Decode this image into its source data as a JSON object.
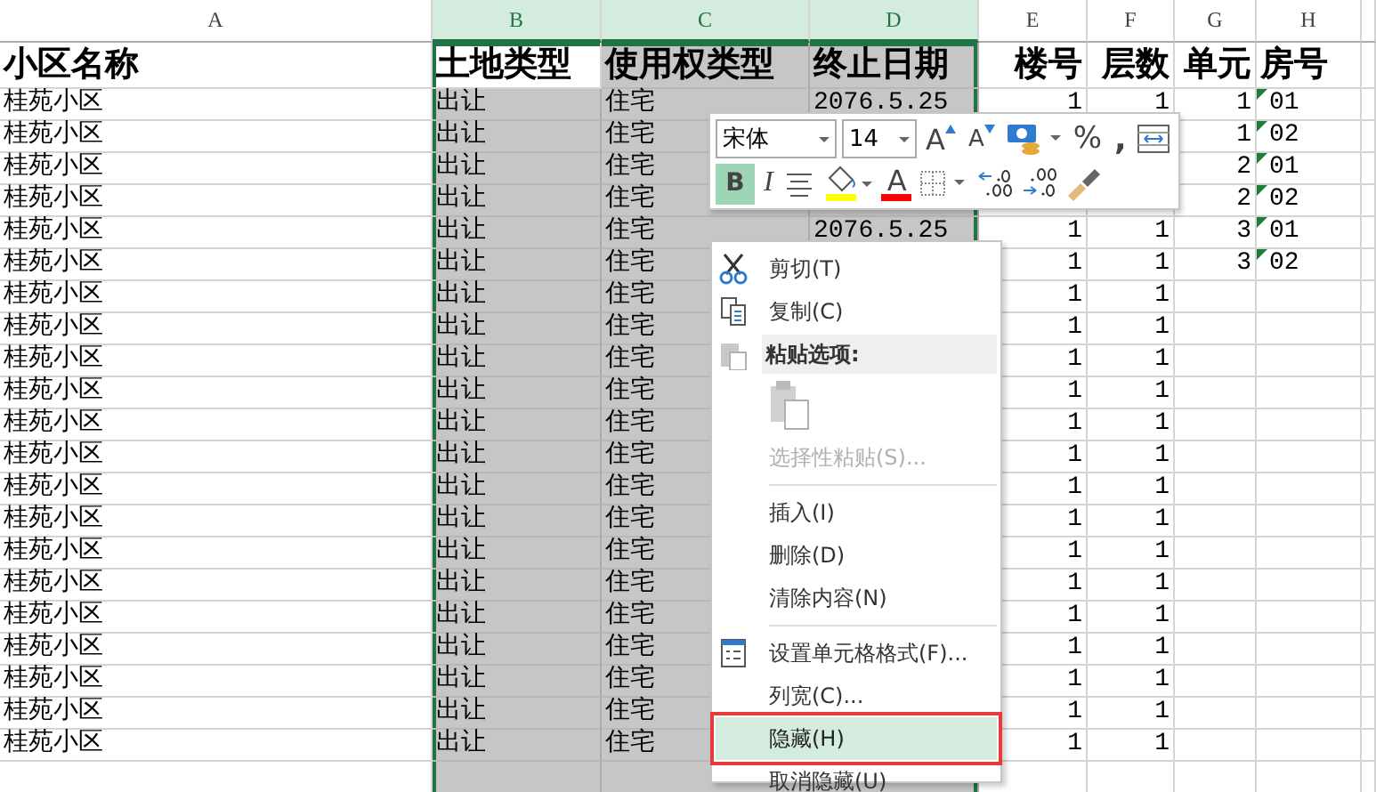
{
  "columns": [
    {
      "label": "A",
      "selected": false
    },
    {
      "label": "B",
      "selected": true
    },
    {
      "label": "C",
      "selected": true
    },
    {
      "label": "D",
      "selected": true
    },
    {
      "label": "E",
      "selected": false
    },
    {
      "label": "F",
      "selected": false
    },
    {
      "label": "G",
      "selected": false
    },
    {
      "label": "H",
      "selected": false
    }
  ],
  "header_row": [
    {
      "text": "小区名称",
      "active": false
    },
    {
      "text": "土地类型",
      "active": true
    },
    {
      "text": "使用权类型",
      "active": false
    },
    {
      "text": "终止日期",
      "active": false
    },
    {
      "text": "楼号",
      "active": false
    },
    {
      "text": "层数",
      "active": false
    },
    {
      "text": "单元",
      "active": false
    },
    {
      "text": "房号",
      "active": false
    }
  ],
  "rows": [
    {
      "cells": [
        "桂苑小区",
        "出让",
        "住宅",
        "2076.5.25",
        "1",
        "1",
        "1",
        "01"
      ],
      "text_number_flag": true
    },
    {
      "cells": [
        "桂苑小区",
        "出让",
        "住宅",
        null,
        null,
        null,
        "1",
        "02"
      ],
      "text_number_flag": true
    },
    {
      "cells": [
        "桂苑小区",
        "出让",
        "住宅",
        null,
        null,
        null,
        "2",
        "01"
      ],
      "text_number_flag": true
    },
    {
      "cells": [
        "桂苑小区",
        "出让",
        "住宅",
        null,
        null,
        null,
        "2",
        "02"
      ],
      "text_number_flag": true
    },
    {
      "cells": [
        "桂苑小区",
        "出让",
        "住宅",
        "2076.5.25",
        "1",
        "1",
        "3",
        "01"
      ],
      "text_number_flag": true
    },
    {
      "cells": [
        "桂苑小区",
        "出让",
        "住宅",
        null,
        "1",
        "1",
        "3",
        "02"
      ],
      "text_number_flag": true
    },
    {
      "cells": [
        "桂苑小区",
        "出让",
        "住宅",
        null,
        "1",
        "1",
        null,
        null
      ],
      "text_number_flag": false
    },
    {
      "cells": [
        "桂苑小区",
        "出让",
        "住宅",
        null,
        "1",
        "1",
        null,
        null
      ],
      "text_number_flag": false
    },
    {
      "cells": [
        "桂苑小区",
        "出让",
        "住宅",
        null,
        "1",
        "1",
        null,
        null
      ],
      "text_number_flag": false
    },
    {
      "cells": [
        "桂苑小区",
        "出让",
        "住宅",
        null,
        "1",
        "1",
        null,
        null
      ],
      "text_number_flag": false
    },
    {
      "cells": [
        "桂苑小区",
        "出让",
        "住宅",
        null,
        "1",
        "1",
        null,
        null
      ],
      "text_number_flag": false
    },
    {
      "cells": [
        "桂苑小区",
        "出让",
        "住宅",
        null,
        "1",
        "1",
        null,
        null
      ],
      "text_number_flag": false
    },
    {
      "cells": [
        "桂苑小区",
        "出让",
        "住宅",
        null,
        "1",
        "1",
        null,
        null
      ],
      "text_number_flag": false
    },
    {
      "cells": [
        "桂苑小区",
        "出让",
        "住宅",
        null,
        "1",
        "1",
        null,
        null
      ],
      "text_number_flag": false
    },
    {
      "cells": [
        "桂苑小区",
        "出让",
        "住宅",
        null,
        "1",
        "1",
        null,
        null
      ],
      "text_number_flag": false
    },
    {
      "cells": [
        "桂苑小区",
        "出让",
        "住宅",
        null,
        "1",
        "1",
        null,
        null
      ],
      "text_number_flag": false
    },
    {
      "cells": [
        "桂苑小区",
        "出让",
        "住宅",
        null,
        "1",
        "1",
        null,
        null
      ],
      "text_number_flag": false
    },
    {
      "cells": [
        "桂苑小区",
        "出让",
        "住宅",
        null,
        "1",
        "1",
        null,
        null
      ],
      "text_number_flag": false
    },
    {
      "cells": [
        "桂苑小区",
        "出让",
        "住宅",
        null,
        "1",
        "1",
        null,
        null
      ],
      "text_number_flag": false
    },
    {
      "cells": [
        "桂苑小区",
        "出让",
        "住宅",
        null,
        "1",
        "1",
        null,
        null
      ],
      "text_number_flag": false
    },
    {
      "cells": [
        "桂苑小区",
        "出让",
        "住宅",
        null,
        "1",
        "1",
        null,
        null
      ],
      "text_number_flag": false
    }
  ],
  "mini_toolbar": {
    "font": "宋体",
    "size": "14",
    "row1": [
      {
        "kind": "grow",
        "label": "A"
      },
      {
        "kind": "shrink",
        "label": "A"
      },
      {
        "kind": "accounting"
      },
      {
        "kind": "percent",
        "label": "%"
      },
      {
        "kind": "comma",
        "label": ","
      },
      {
        "kind": "merge"
      }
    ],
    "row2": [
      {
        "kind": "bold",
        "label": "B",
        "selected": true
      },
      {
        "kind": "italic",
        "label": "I",
        "selected": false
      },
      {
        "kind": "align"
      },
      {
        "kind": "fill",
        "color": "#ffff00"
      },
      {
        "kind": "fontcolor",
        "label": "A",
        "color": "#ff0000"
      },
      {
        "kind": "borders"
      },
      {
        "kind": "incdec"
      },
      {
        "kind": "decdec"
      },
      {
        "kind": "painter"
      }
    ]
  },
  "context_menu": [
    {
      "kind": "cut",
      "text": "剪切(T)",
      "disabled": false,
      "selected": false,
      "outlined": false
    },
    {
      "kind": "copy",
      "text": "复制(C)",
      "disabled": false,
      "selected": false,
      "outlined": false
    },
    {
      "kind": "paste-header",
      "text": "粘贴选项:"
    },
    {
      "kind": "paste-option",
      "disabled": true
    },
    {
      "kind": "command",
      "text": "选择性粘贴(S)...",
      "disabled": true,
      "selected": false,
      "outlined": false
    },
    {
      "kind": "separator"
    },
    {
      "kind": "command",
      "text": "插入(I)",
      "disabled": false,
      "selected": false,
      "outlined": false
    },
    {
      "kind": "command",
      "text": "删除(D)",
      "disabled": false,
      "selected": false,
      "outlined": false
    },
    {
      "kind": "command",
      "text": "清除内容(N)",
      "disabled": false,
      "selected": false,
      "outlined": false
    },
    {
      "kind": "separator"
    },
    {
      "kind": "format",
      "text": "设置单元格格式(F)...",
      "disabled": false,
      "selected": false,
      "outlined": false
    },
    {
      "kind": "command",
      "text": "列宽(C)...",
      "disabled": false,
      "selected": false,
      "outlined": false
    },
    {
      "kind": "command",
      "text": "隐藏(H)",
      "disabled": false,
      "selected": true,
      "outlined": true
    },
    {
      "kind": "command",
      "text": "取消隐藏(U)",
      "disabled": false,
      "selected": false,
      "outlined": false
    }
  ]
}
